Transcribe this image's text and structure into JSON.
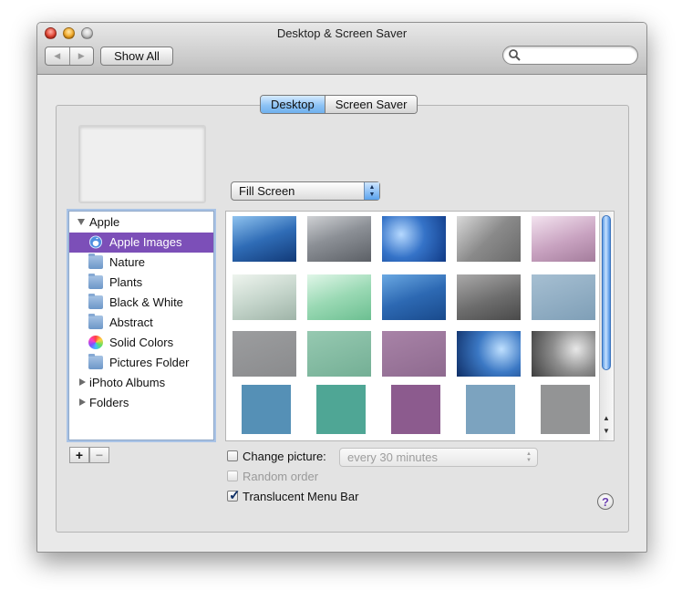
{
  "window": {
    "title": "Desktop & Screen Saver"
  },
  "toolbar": {
    "show_all_label": "Show All",
    "search_placeholder": ""
  },
  "tabs": [
    {
      "label": "Desktop",
      "selected": true
    },
    {
      "label": "Screen Saver",
      "selected": false
    }
  ],
  "fit_popup": {
    "value": "Fill Screen"
  },
  "sources": {
    "apple": {
      "label": "Apple",
      "expanded": true
    },
    "items": [
      {
        "label": "Apple Images",
        "icon": "apple-icon",
        "selected": true
      },
      {
        "label": "Nature",
        "icon": "folder-icon"
      },
      {
        "label": "Plants",
        "icon": "folder-icon"
      },
      {
        "label": "Black & White",
        "icon": "folder-icon"
      },
      {
        "label": "Abstract",
        "icon": "folder-icon"
      },
      {
        "label": "Solid Colors",
        "icon": "color-wheel-icon"
      },
      {
        "label": "Pictures Folder",
        "icon": "pictures-folder-icon"
      }
    ],
    "iphoto": {
      "label": "iPhoto Albums",
      "expanded": false
    },
    "folders": {
      "label": "Folders",
      "expanded": false
    }
  },
  "list_buttons": {
    "add": "+",
    "remove": "−"
  },
  "options": {
    "change_picture": {
      "label": "Change picture:",
      "checked": false
    },
    "interval": {
      "value": "every 30 minutes",
      "enabled": false
    },
    "random_order": {
      "label": "Random order",
      "checked": false,
      "enabled": false
    },
    "translucent_menu_bar": {
      "label": "Translucent Menu Bar",
      "checked": true
    }
  },
  "help": {
    "label": "?"
  },
  "colors": {
    "selection": "#7c4fb8",
    "accent": "#5aa3ee"
  }
}
